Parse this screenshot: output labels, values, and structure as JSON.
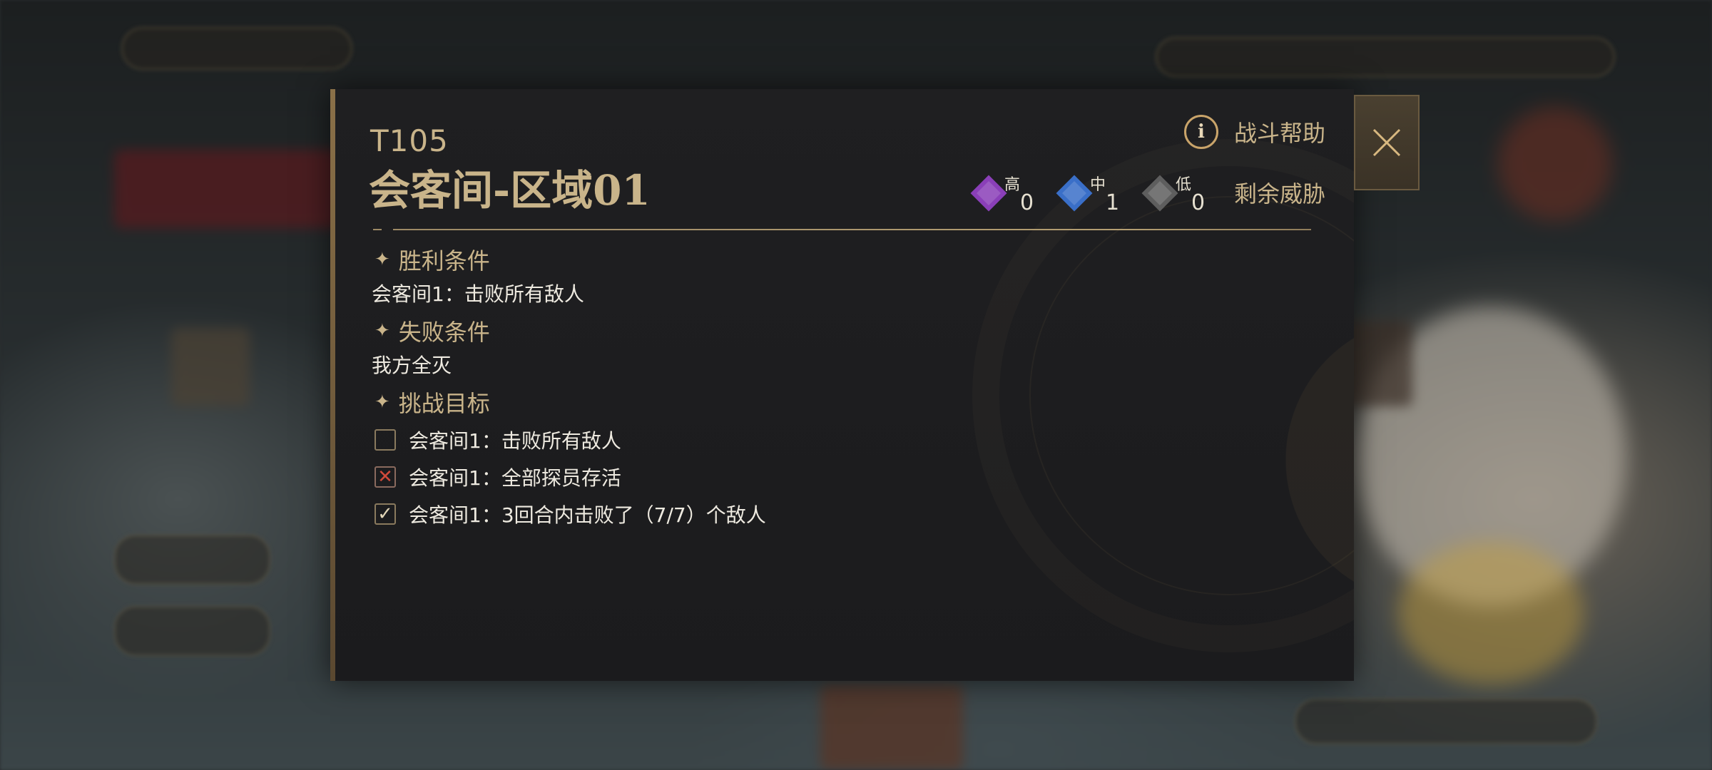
{
  "stage": {
    "code": "T105",
    "name": "会客间-区域01"
  },
  "help": {
    "icon": "info-icon",
    "label": "战斗帮助"
  },
  "threat": {
    "label": "剩余威胁",
    "levels": [
      {
        "tier": "高",
        "count": "0",
        "color": "#8a3fb8"
      },
      {
        "tier": "中",
        "count": "1",
        "color": "#3a6fc8"
      },
      {
        "tier": "低",
        "count": "0",
        "color": "#5e5e5e"
      }
    ]
  },
  "victory": {
    "title": "胜利条件",
    "text": "会客间1：击败所有敌人"
  },
  "defeat": {
    "title": "失败条件",
    "text": "我方全灭"
  },
  "challenge": {
    "title": "挑战目标",
    "goals": [
      {
        "state": "empty",
        "text": "会客间1：击败所有敌人"
      },
      {
        "state": "failed",
        "text": "会客间1：全部探员存活"
      },
      {
        "state": "done",
        "text": "会客间1：3回合内击败了（7/7）个敌人"
      }
    ]
  },
  "close": {
    "icon": "close-icon"
  }
}
